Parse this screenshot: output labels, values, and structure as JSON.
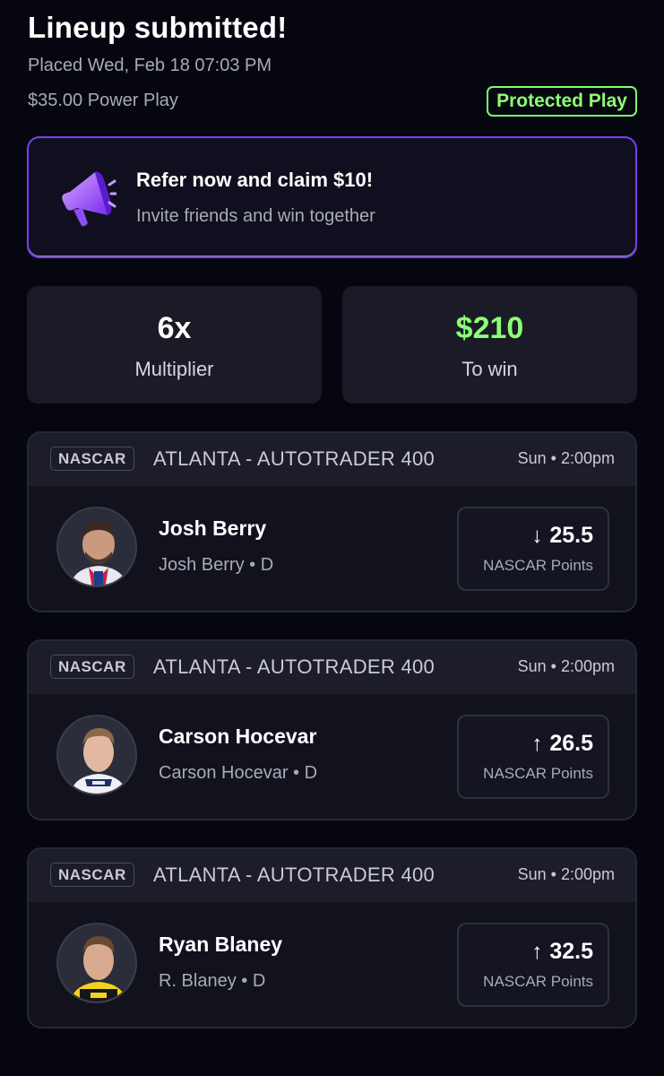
{
  "header": {
    "title": "Lineup submitted!",
    "placed": "Placed Wed, Feb 18 07:03 PM",
    "stake": "$35.00 Power Play",
    "badge": "Protected Play"
  },
  "refer": {
    "title": "Refer now and claim $10!",
    "subtitle": "Invite friends and win together",
    "icon": "megaphone-icon"
  },
  "stats": {
    "multiplier_value": "6x",
    "multiplier_label": "Multiplier",
    "win_value": "$210",
    "win_label": "To win"
  },
  "picks": [
    {
      "league": "NASCAR",
      "event": "ATLANTA - AUTOTRADER 400",
      "time": "Sun • 2:00pm",
      "name": "Josh Berry",
      "sub": "Josh Berry • D",
      "direction": "down",
      "arrow": "↓",
      "value": "25.5",
      "stat": "NASCAR Points"
    },
    {
      "league": "NASCAR",
      "event": "ATLANTA - AUTOTRADER 400",
      "time": "Sun • 2:00pm",
      "name": "Carson Hocevar",
      "sub": "Carson Hocevar • D",
      "direction": "up",
      "arrow": "↑",
      "value": "26.5",
      "stat": "NASCAR Points"
    },
    {
      "league": "NASCAR",
      "event": "ATLANTA - AUTOTRADER 400",
      "time": "Sun • 2:00pm",
      "name": "Ryan Blaney",
      "sub": "R. Blaney • D",
      "direction": "up",
      "arrow": "↑",
      "value": "32.5",
      "stat": "NASCAR Points"
    }
  ],
  "colors": {
    "background": "#05060f",
    "accent_green": "#8dff74",
    "accent_purple": "#7b3ff2"
  }
}
